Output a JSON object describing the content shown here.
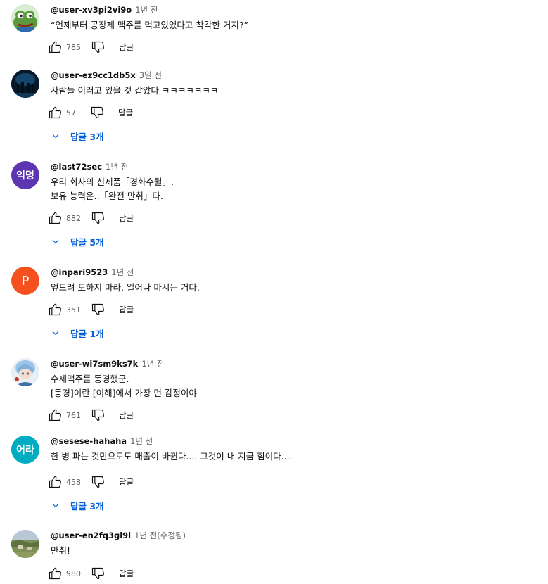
{
  "comments": [
    {
      "author": "@user-xv3pi2vi9o",
      "time": "1년 전",
      "lines": [
        "“언제부터 공장제 맥주를 먹고있었다고 착각한 거지?”"
      ],
      "likes": "785",
      "reply_label": "답글",
      "avatar": {
        "type": "image",
        "icon": "frog-avatar-icon",
        "color": "#5a8a3a"
      }
    },
    {
      "author": "@user-ez9cc1db5x",
      "time": "3일 전",
      "lines": [
        "사람들 이러고 있을 것 같았다 ㅋㅋㅋㅋㅋㅋㅋ"
      ],
      "likes": "57",
      "reply_label": "답글",
      "replies_label": "답글 3개",
      "avatar": {
        "type": "image",
        "icon": "night-scene-avatar-icon",
        "color": "#0c2236"
      }
    },
    {
      "author": "@last72sec",
      "time": "1년 전",
      "lines": [
        "우리 회사의 신제품「경화수월」.",
        "보유 능력은..「완전 만취」다."
      ],
      "likes": "882",
      "reply_label": "답글",
      "replies_label": "답글 5개",
      "avatar": {
        "type": "text",
        "text": "익명",
        "color": "#5e35b1"
      }
    },
    {
      "author": "@inpari9523",
      "time": "1년 전",
      "lines": [
        "엎드려 토하지 마라. 일어나 마시는 거다."
      ],
      "likes": "351",
      "reply_label": "답글",
      "replies_label": "답글 1개",
      "avatar": {
        "type": "text",
        "text": "P",
        "color": "#f4511e"
      }
    },
    {
      "author": "@user-wi7sm9ks7k",
      "time": "1년 전",
      "lines": [
        "수제맥주를 동경했군.",
        "[동경]이란 [이해]에서 가장 먼 감정이야"
      ],
      "likes": "761",
      "reply_label": "답글",
      "avatar": {
        "type": "image",
        "icon": "anime-character-avatar-icon",
        "color": "#8fb3d9"
      }
    },
    {
      "author": "@sesese-hahaha",
      "time": "1년 전",
      "lines": [
        "한 병 파는 것만으로도 매출이 바뀐다.... 그것이 내 지금 힘이다...."
      ],
      "likes": "458",
      "reply_label": "답글",
      "replies_label": "답글 3개",
      "avatar": {
        "type": "text",
        "text": "어라",
        "color": "#00acc1"
      }
    },
    {
      "author": "@user-en2fq3gl9l",
      "time": "1년 전(수정됨)",
      "lines": [
        "만취!"
      ],
      "likes": "980",
      "reply_label": "답글",
      "avatar": {
        "type": "image",
        "icon": "landscape-avatar-icon",
        "color": "#8a9a6a"
      }
    }
  ]
}
